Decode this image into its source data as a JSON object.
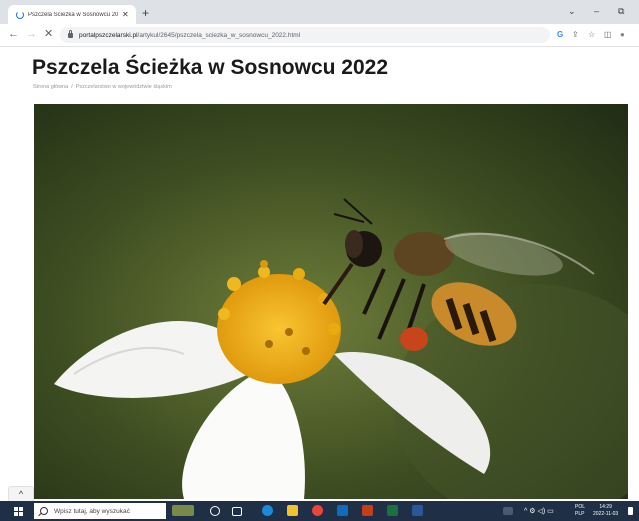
{
  "browser": {
    "tab_title": "Pszczela Ścieżka w Sosnowcu 20",
    "tab_close": "✕",
    "new_tab": "+",
    "url_host": "portalpszczelarski.pl",
    "url_path": "/artykul/2645/pszczela_sciezka_w_sosnowcu_2022.html",
    "nav_back": "←",
    "nav_forward": "→",
    "nav_stop": "✕",
    "win_chevron": "⌄",
    "win_minimize": "–",
    "win_restore": "⧉",
    "toolbar_icons": [
      "G",
      "⇪",
      "☆",
      "◫",
      "●"
    ]
  },
  "page": {
    "title": "Pszczela Ścieżka w Sosnowcu 2022",
    "breadcrumb": [
      "Strona główna",
      "Pszczelarstwo w województwie śląskim"
    ],
    "breadcrumb_sep": "/",
    "scroll_top_glyph": "^"
  },
  "taskbar": {
    "search_placeholder": "Wpisz tutaj, aby wyszukać",
    "lang_line1": "POL",
    "lang_line2": "PLP",
    "time": "14:29",
    "date": "2022-11-03",
    "tray_icons": "^ ⚙ ◁) ▭"
  },
  "colors": {
    "taskbar_bg": "#1f2f45",
    "tab_strip": "#dee1e6",
    "accent": "#1a73e8"
  }
}
